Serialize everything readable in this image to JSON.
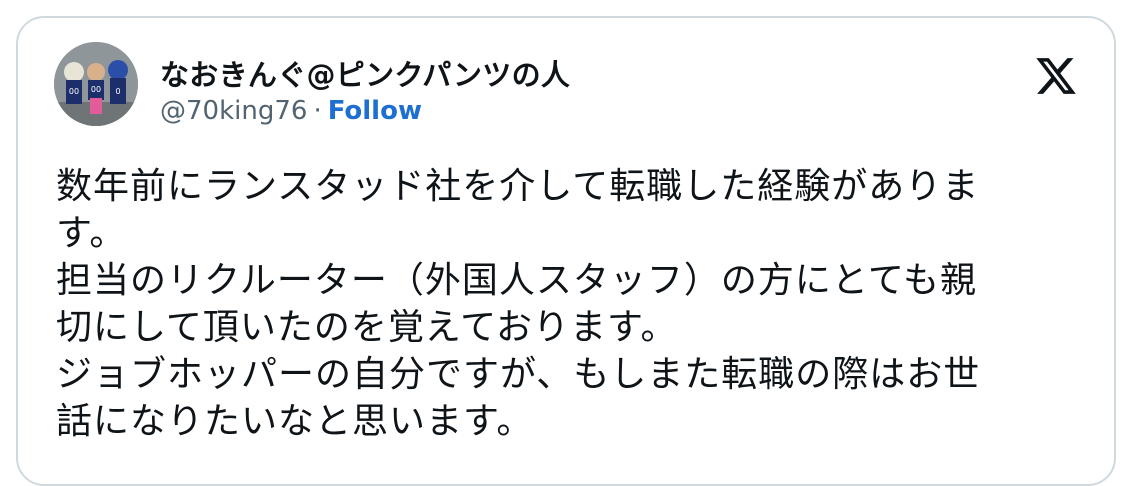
{
  "author": {
    "display_name": "なおきんぐ@ピンクパンツの人",
    "handle": "@70king76",
    "separator": "·",
    "follow_label": "Follow"
  },
  "brand": {
    "icon": "x-logo-icon",
    "color": "#0f1419"
  },
  "colors": {
    "follow": "#1d6fd1",
    "text": "#0f1419",
    "muted": "#536471",
    "border": "#cfd9de"
  },
  "tweet": {
    "lines": [
      "数年前にランスタッド社を介して転職した経験がありま",
      "す。",
      "担当のリクルーター（外国人スタッフ）の方にとても親",
      "切にして頂いたのを覚えております。",
      "ジョブホッパーの自分ですが、もしまた転職の際はお世",
      "話になりたいなと思います。"
    ]
  }
}
